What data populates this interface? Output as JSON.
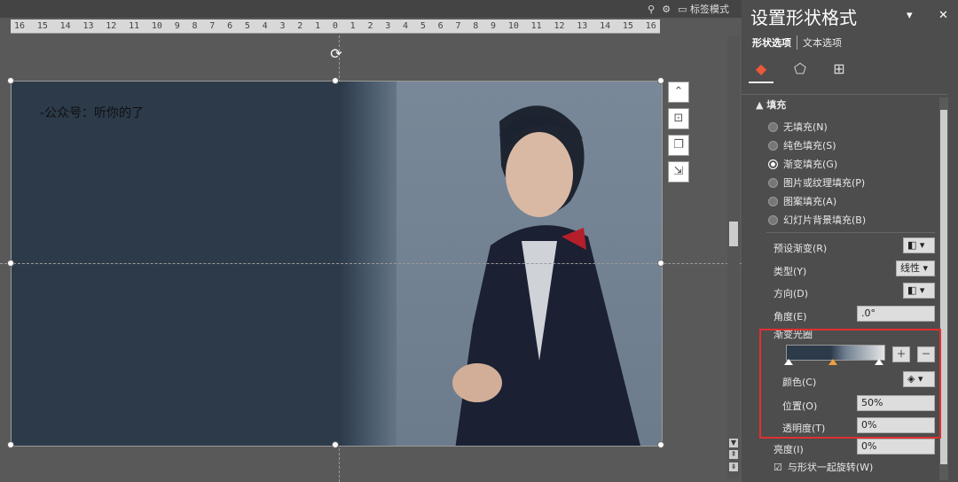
{
  "topbar": {
    "label_mode": "标签模式"
  },
  "ruler": [
    "16",
    "15",
    "14",
    "13",
    "12",
    "11",
    "10",
    "9",
    "8",
    "7",
    "6",
    "5",
    "4",
    "3",
    "2",
    "1",
    "0",
    "1",
    "2",
    "3",
    "4",
    "5",
    "6",
    "7",
    "8",
    "9",
    "10",
    "11",
    "12",
    "13",
    "14",
    "15",
    "16"
  ],
  "slide": {
    "text": "-公众号：听你的了"
  },
  "panel": {
    "title": "设置形状格式",
    "tab_shape": "形状选项",
    "tab_text": "文本选项",
    "section_fill": "▲ 填充",
    "fill_options": [
      "无填充(N)",
      "纯色填充(S)",
      "渐变填充(G)",
      "图片或纹理填充(P)",
      "图案填充(A)",
      "幻灯片背景填充(B)"
    ],
    "preset_label": "预设渐变(R)",
    "type_label": "类型(Y)",
    "type_value": "线性",
    "direction_label": "方向(D)",
    "angle_label": "角度(E)",
    "angle_value": ".0°",
    "gradient_stops_label": "渐变光圈",
    "color_label": "颜色(C)",
    "position_label": "位置(O)",
    "position_value": "50%",
    "transparency_label": "透明度(T)",
    "transparency_value": "0%",
    "brightness_label": "亮度(I)",
    "brightness_value": "0%",
    "rotate_label": "与形状一起旋转(W)"
  }
}
